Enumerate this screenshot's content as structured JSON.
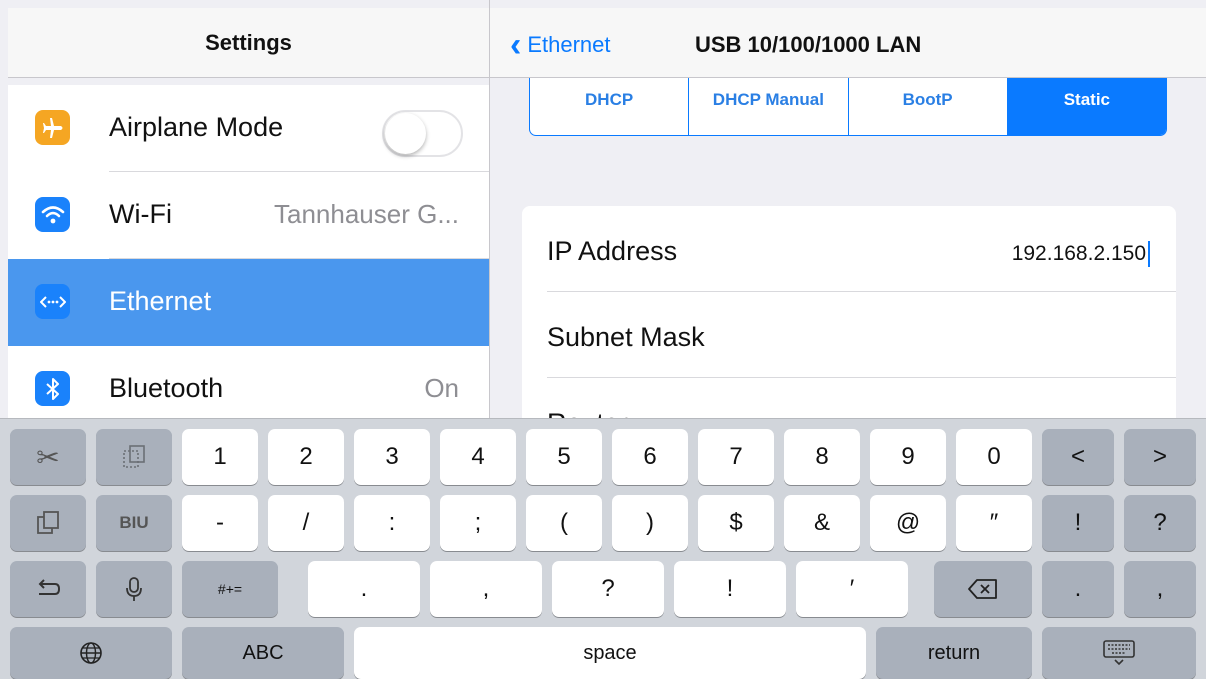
{
  "sidebar": {
    "title": "Settings",
    "items": [
      {
        "label": "Airplane Mode",
        "icon": "airplane-icon",
        "icon_color": "#f5a623",
        "toggle": "off"
      },
      {
        "label": "Wi-Fi",
        "detail": "Tannhauser G...",
        "icon": "wifi-icon",
        "icon_color": "#1a82fb"
      },
      {
        "label": "Ethernet",
        "icon": "ethernet-icon",
        "icon_color": "#1a82fb",
        "selected": true
      },
      {
        "label": "Bluetooth",
        "detail": "On",
        "icon": "bluetooth-icon",
        "icon_color": "#1a82fb"
      }
    ]
  },
  "detail": {
    "back_label": "Ethernet",
    "title": "USB 10/100/1000 LAN",
    "segments": [
      "DHCP",
      "DHCP Manual",
      "BootP",
      "Static"
    ],
    "selected_segment": "Static",
    "fields": [
      {
        "label": "IP Address",
        "value": "192.168.2.150"
      },
      {
        "label": "Subnet Mask",
        "value": ""
      },
      {
        "label": "Router",
        "value": ""
      }
    ]
  },
  "keyboard": {
    "row1": [
      "1",
      "2",
      "3",
      "4",
      "5",
      "6",
      "7",
      "8",
      "9",
      "0"
    ],
    "row2": [
      "-",
      "/",
      ":",
      ";",
      "(",
      ")",
      "$",
      "&",
      "@",
      "″"
    ],
    "row2_right": [
      "!",
      "?"
    ],
    "row3": [
      ".",
      ",",
      "?",
      "!",
      "′"
    ],
    "row3_right": [
      ".",
      ","
    ],
    "shift_label": "#+=",
    "abc_label": "ABC",
    "space_label": "space",
    "return_label": "return",
    "format_label": "BIU",
    "nav_left": "<",
    "nav_right": ">"
  },
  "colors": {
    "accent": "#0a7aff",
    "selection": "#4a97ee"
  }
}
